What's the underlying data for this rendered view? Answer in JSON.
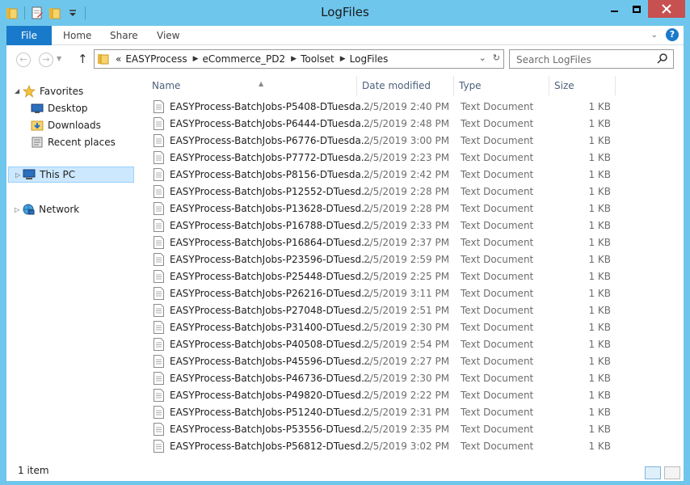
{
  "window": {
    "title": "LogFiles"
  },
  "ribbon": {
    "tabs": [
      {
        "label": "File"
      },
      {
        "label": "Home"
      },
      {
        "label": "Share"
      },
      {
        "label": "View"
      }
    ]
  },
  "address": {
    "prefix": "«",
    "crumbs": [
      "EASYProcess",
      "eCommerce_PD2",
      "Toolset",
      "LogFiles"
    ]
  },
  "search": {
    "placeholder": "Search LogFiles"
  },
  "nav": {
    "favorites": "Favorites",
    "desktop": "Desktop",
    "downloads": "Downloads",
    "recent": "Recent places",
    "this_pc": "This PC",
    "network": "Network"
  },
  "columns": {
    "name": "Name",
    "date": "Date modified",
    "type": "Type",
    "size": "Size"
  },
  "files": [
    {
      "name": "EASYProcess-BatchJobs-P5408-DTuesda...",
      "date": "2/5/2019 2:40 PM",
      "type": "Text Document",
      "size": "1 KB"
    },
    {
      "name": "EASYProcess-BatchJobs-P6444-DTuesda...",
      "date": "2/5/2019 2:48 PM",
      "type": "Text Document",
      "size": "1 KB"
    },
    {
      "name": "EASYProcess-BatchJobs-P6776-DTuesda...",
      "date": "2/5/2019 3:00 PM",
      "type": "Text Document",
      "size": "1 KB"
    },
    {
      "name": "EASYProcess-BatchJobs-P7772-DTuesda...",
      "date": "2/5/2019 2:23 PM",
      "type": "Text Document",
      "size": "1 KB"
    },
    {
      "name": "EASYProcess-BatchJobs-P8156-DTuesda...",
      "date": "2/5/2019 2:42 PM",
      "type": "Text Document",
      "size": "1 KB"
    },
    {
      "name": "EASYProcess-BatchJobs-P12552-DTuesd...",
      "date": "2/5/2019 2:28 PM",
      "type": "Text Document",
      "size": "1 KB"
    },
    {
      "name": "EASYProcess-BatchJobs-P13628-DTuesd...",
      "date": "2/5/2019 2:28 PM",
      "type": "Text Document",
      "size": "1 KB"
    },
    {
      "name": "EASYProcess-BatchJobs-P16788-DTuesd...",
      "date": "2/5/2019 2:33 PM",
      "type": "Text Document",
      "size": "1 KB"
    },
    {
      "name": "EASYProcess-BatchJobs-P16864-DTuesd...",
      "date": "2/5/2019 2:37 PM",
      "type": "Text Document",
      "size": "1 KB"
    },
    {
      "name": "EASYProcess-BatchJobs-P23596-DTuesd...",
      "date": "2/5/2019 2:59 PM",
      "type": "Text Document",
      "size": "1 KB"
    },
    {
      "name": "EASYProcess-BatchJobs-P25448-DTuesd...",
      "date": "2/5/2019 2:25 PM",
      "type": "Text Document",
      "size": "1 KB"
    },
    {
      "name": "EASYProcess-BatchJobs-P26216-DTuesd...",
      "date": "2/5/2019 3:11 PM",
      "type": "Text Document",
      "size": "1 KB"
    },
    {
      "name": "EASYProcess-BatchJobs-P27048-DTuesd...",
      "date": "2/5/2019 2:51 PM",
      "type": "Text Document",
      "size": "1 KB"
    },
    {
      "name": "EASYProcess-BatchJobs-P31400-DTuesd...",
      "date": "2/5/2019 2:30 PM",
      "type": "Text Document",
      "size": "1 KB"
    },
    {
      "name": "EASYProcess-BatchJobs-P40508-DTuesd...",
      "date": "2/5/2019 2:54 PM",
      "type": "Text Document",
      "size": "1 KB"
    },
    {
      "name": "EASYProcess-BatchJobs-P45596-DTuesd...",
      "date": "2/5/2019 2:27 PM",
      "type": "Text Document",
      "size": "1 KB"
    },
    {
      "name": "EASYProcess-BatchJobs-P46736-DTuesd...",
      "date": "2/5/2019 2:30 PM",
      "type": "Text Document",
      "size": "1 KB"
    },
    {
      "name": "EASYProcess-BatchJobs-P49820-DTuesd...",
      "date": "2/5/2019 2:22 PM",
      "type": "Text Document",
      "size": "1 KB"
    },
    {
      "name": "EASYProcess-BatchJobs-P51240-DTuesd...",
      "date": "2/5/2019 2:31 PM",
      "type": "Text Document",
      "size": "1 KB"
    },
    {
      "name": "EASYProcess-BatchJobs-P53556-DTuesd...",
      "date": "2/5/2019 2:35 PM",
      "type": "Text Document",
      "size": "1 KB"
    },
    {
      "name": "EASYProcess-BatchJobs-P56812-DTuesd...",
      "date": "2/5/2019 3:02 PM",
      "type": "Text Document",
      "size": "1 KB"
    }
  ],
  "status": {
    "count": "1 item"
  },
  "colors": {
    "accent": "#1979ca",
    "titlebar": "#6ec6ec",
    "selection": "#cce8ff"
  }
}
